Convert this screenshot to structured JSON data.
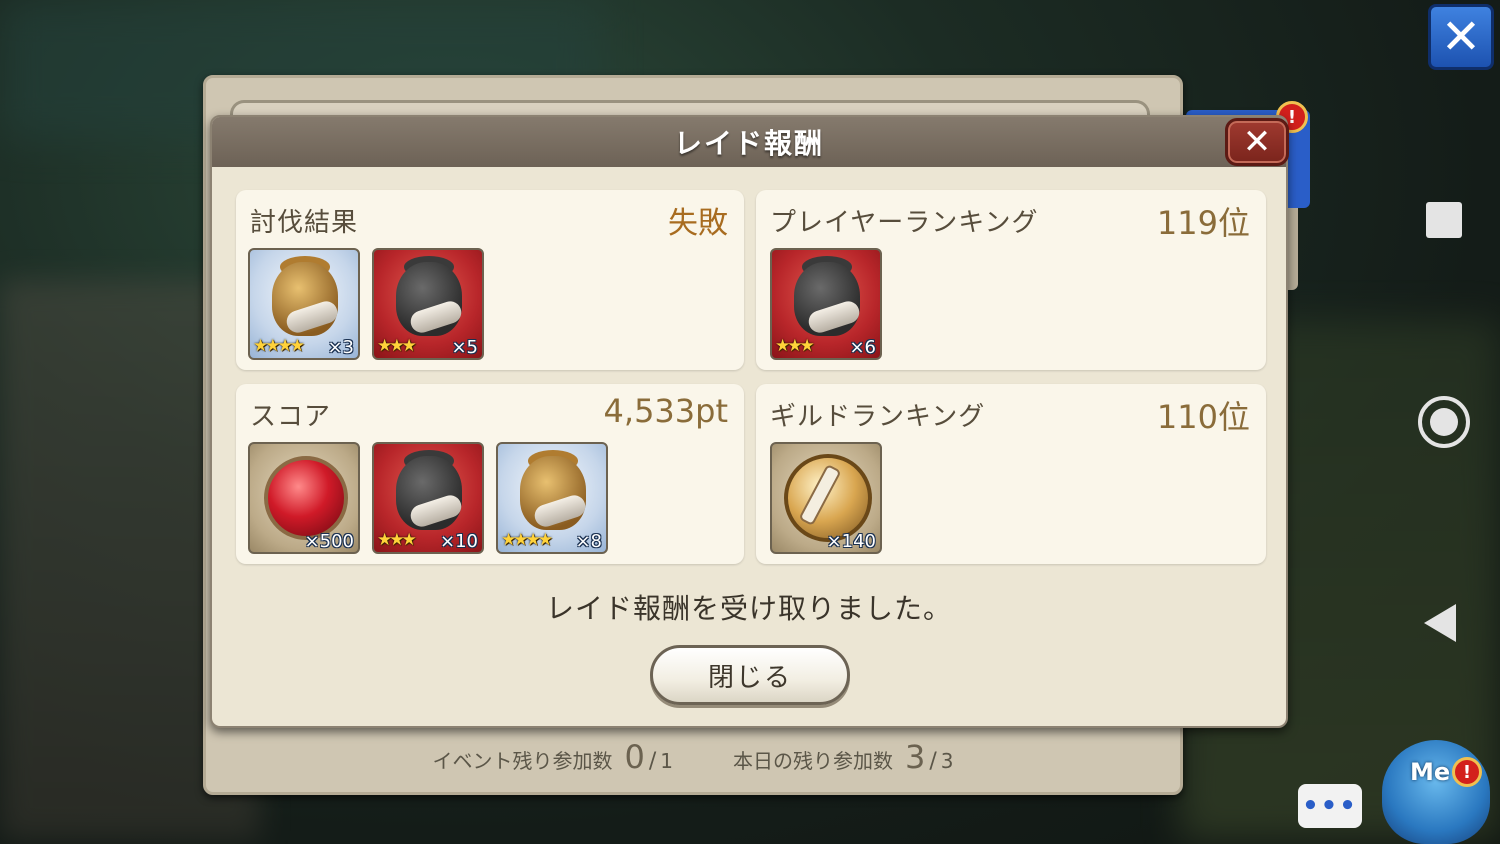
{
  "dialog": {
    "title": "レイド報酬",
    "close_icon": "✕",
    "message": "レイド報酬を受け取りました。",
    "close_button": "閉じる"
  },
  "cards": {
    "battle_result": {
      "title": "討伐結果",
      "value": "失敗",
      "items": [
        {
          "icon": "gold-bag-icon",
          "stars": "★★★★",
          "qty": "×3"
        },
        {
          "icon": "dark-bag-icon",
          "stars": "★★★",
          "qty": "×5"
        }
      ]
    },
    "player_ranking": {
      "title": "プレイヤーランキング",
      "value": "119位",
      "items": [
        {
          "icon": "dark-bag-icon",
          "stars": "★★★",
          "qty": "×6"
        }
      ]
    },
    "score": {
      "title": "スコア",
      "value": "4,533pt",
      "items": [
        {
          "icon": "red-gem-icon",
          "qty": "×500"
        },
        {
          "icon": "dark-bag-icon",
          "stars": "★★★",
          "qty": "×10"
        },
        {
          "icon": "gold-bag-icon",
          "stars": "★★★★",
          "qty": "×8"
        }
      ]
    },
    "guild_ranking": {
      "title": "ギルドランキング",
      "value": "110位",
      "items": [
        {
          "icon": "gold-medal-icon",
          "qty": "×140"
        }
      ]
    }
  },
  "footer": {
    "event_label": "イベント残り参加数",
    "event_count": "0",
    "event_total": "1",
    "daily_label": "本日の残り参加数",
    "daily_count": "3",
    "daily_total": "3"
  },
  "overlay": {
    "exit_icon": "✕",
    "badge": "!",
    "chat_dots": "•••",
    "me_label": "Me",
    "me_badge": "!"
  }
}
